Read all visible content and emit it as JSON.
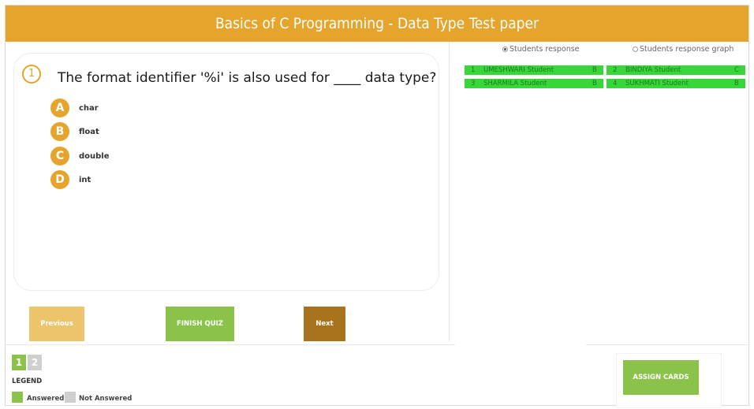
{
  "header": {
    "title": "Basics of C Programming - Data Type Test paper"
  },
  "question": {
    "number": "1",
    "text": "The format identifier '%i' is also used for ____ data type?",
    "options": [
      {
        "letter": "A",
        "text": "char"
      },
      {
        "letter": "B",
        "text": "float"
      },
      {
        "letter": "C",
        "text": "double"
      },
      {
        "letter": "D",
        "text": "int"
      }
    ]
  },
  "view_toggle": {
    "students_response": "Students response",
    "students_response_graph": "Students response graph",
    "selected": "students_response"
  },
  "responses": [
    {
      "no": "1",
      "name": "UMESHWARI Student",
      "answer": "B"
    },
    {
      "no": "2",
      "name": "BINDIYA Student",
      "answer": "C"
    },
    {
      "no": "3",
      "name": "SHARMILA Student",
      "answer": "B"
    },
    {
      "no": "4",
      "name": "SUKHMATI Student",
      "answer": "B"
    }
  ],
  "buttons": {
    "previous": "Previous",
    "finish": "FINISH QUIZ",
    "next": "Next",
    "assign_cards": "ASSIGN CARDS"
  },
  "pager": {
    "pages": [
      "1",
      "2"
    ],
    "current": "1"
  },
  "legend": {
    "title": "LEGEND",
    "answered": "Answered",
    "not_answered": "Not Answered"
  },
  "colors": {
    "accent": "#e5a42c",
    "answered": "#8bc34a",
    "not_answered": "#cfcfcf",
    "response_row": "#38d63b",
    "previous_btn": "#ebc46b",
    "next_btn": "#a8731c"
  }
}
